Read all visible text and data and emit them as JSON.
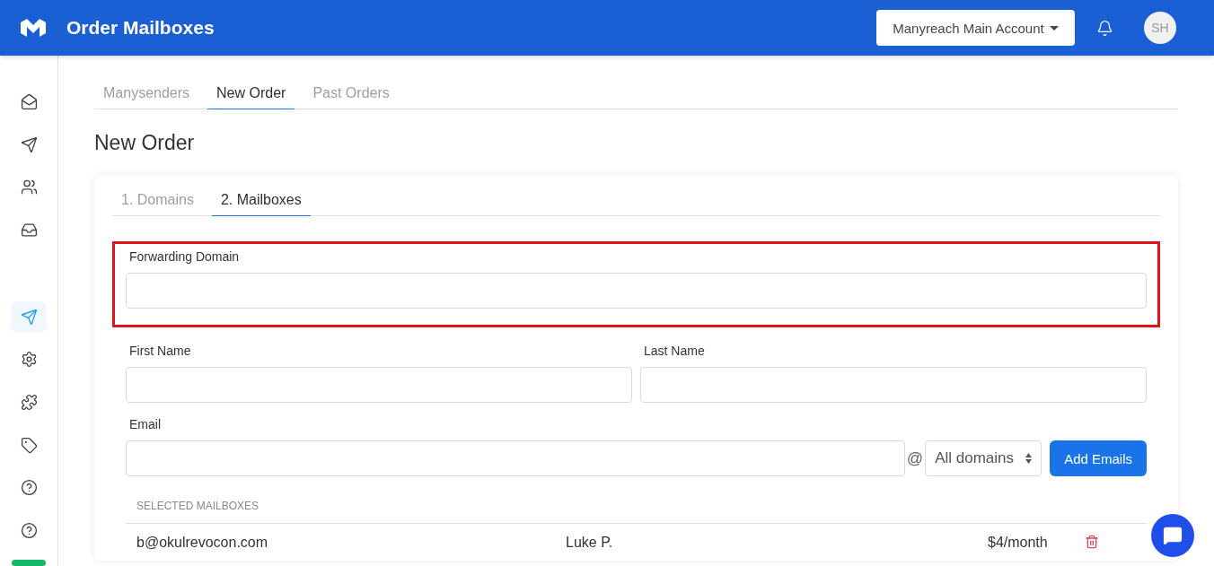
{
  "header": {
    "title": "Order Mailboxes",
    "account": "Manyreach Main Account",
    "avatar": "SH"
  },
  "sidebar": {
    "items": [
      {
        "kind": "mail",
        "selected": false
      },
      {
        "kind": "send",
        "selected": false
      },
      {
        "kind": "users",
        "selected": false
      },
      {
        "kind": "inbox",
        "selected": false
      },
      {
        "kind": "send",
        "selected": true
      },
      {
        "kind": "settings",
        "selected": false
      },
      {
        "kind": "puzzle",
        "selected": false
      },
      {
        "kind": "tag",
        "selected": false
      },
      {
        "kind": "help",
        "selected": false
      },
      {
        "kind": "help",
        "selected": false
      }
    ]
  },
  "tabs": [
    {
      "label": "Manysenders",
      "selected": false
    },
    {
      "label": "New Order",
      "selected": true
    },
    {
      "label": "Past Orders",
      "selected": false
    }
  ],
  "page_title": "New Order",
  "steps": [
    {
      "label": "1. Domains",
      "selected": false
    },
    {
      "label": "2. Mailboxes",
      "selected": true
    }
  ],
  "forwarding": {
    "label": "Forwarding Domain",
    "highlighted": true
  },
  "first_name": {
    "label": "First Name"
  },
  "last_name": {
    "label": "Last Name"
  },
  "email": {
    "label": "Email",
    "at": "@",
    "domain": "All domains",
    "button": "Add Emails"
  },
  "selected": {
    "heading": "SELECTED MAILBOXES",
    "rows": [
      {
        "email": "b@okulrevocon.com",
        "name": "Luke P.",
        "price": "$4/month"
      }
    ]
  }
}
